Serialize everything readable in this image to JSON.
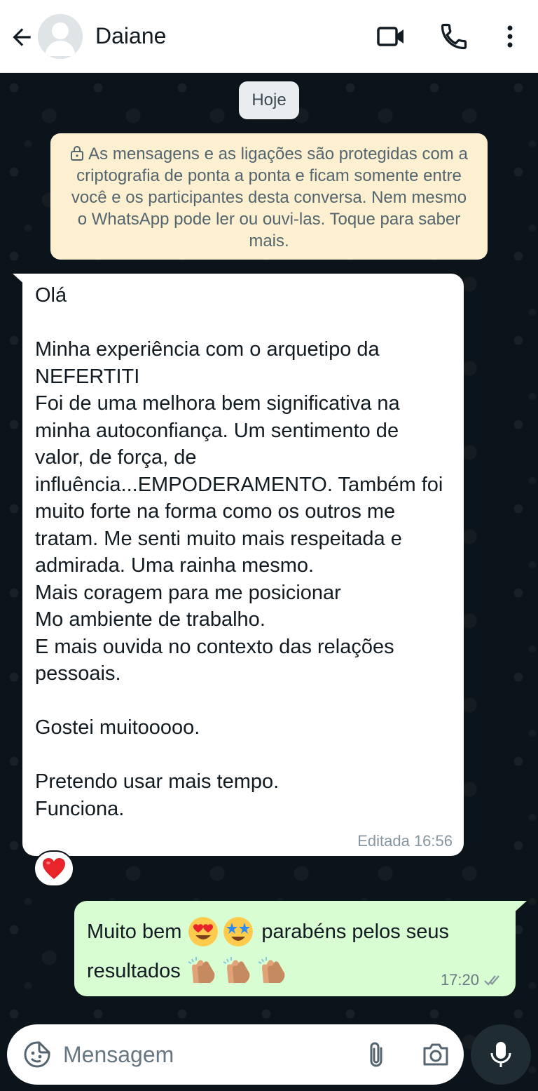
{
  "header": {
    "contact_name": "Daiane",
    "icons": [
      "back-arrow-icon",
      "avatar",
      "video-call-icon",
      "phone-icon",
      "more-vert-icon"
    ]
  },
  "chat": {
    "date_chip": "Hoje",
    "encryption_notice": "As mensagens e as ligações são protegidas com a criptografia de ponta a ponta e ficam somente entre você e os participantes desta conversa. Nem mesmo o WhatsApp pode ler ou ouvi-las. Toque para saber mais.",
    "incoming": {
      "text": "Olá\n\nMinha experiência com o arquetipo da NEFERTITI\nFoi de uma melhora bem significativa na minha autoconfiança. Um sentimento de valor, de força, de influência...EMPODERAMENTO. Também foi muito forte na forma como os outros me tratam. Me senti muito mais respeitada e admirada. Uma rainha mesmo.\nMais coragem para me posicionar\nMo ambiente de trabalho.\nE mais ouvida no contexto das relações pessoais.\n\nGostei muitooooo.\n\nPretendo usar mais tempo.\nFunciona.",
      "meta": "Editada 16:56",
      "reaction": "red-heart-emoji"
    },
    "outgoing": {
      "line1_start": "Muito bem",
      "line1_end": "parabéns pelos seus",
      "line2_start": "resultados",
      "emojis_line1": [
        "heart-eyes-emoji",
        "star-struck-emoji"
      ],
      "emojis_line2": [
        "clapping-hands-emoji",
        "clapping-hands-emoji",
        "clapping-hands-emoji"
      ],
      "time": "17:20",
      "status": "delivered-double-check"
    }
  },
  "composer": {
    "placeholder": "Mensagem",
    "icons": [
      "sticker-emoji-icon",
      "attach-icon",
      "camera-icon",
      "mic-icon"
    ]
  },
  "colors": {
    "header_bg": "#ffffff",
    "chat_bg": "#0b141a",
    "banner_bg": "#fdf0d1",
    "incoming_bubble": "#ffffff",
    "outgoing_bubble": "#d9fdd3",
    "mic_button": "#1f2c33"
  }
}
